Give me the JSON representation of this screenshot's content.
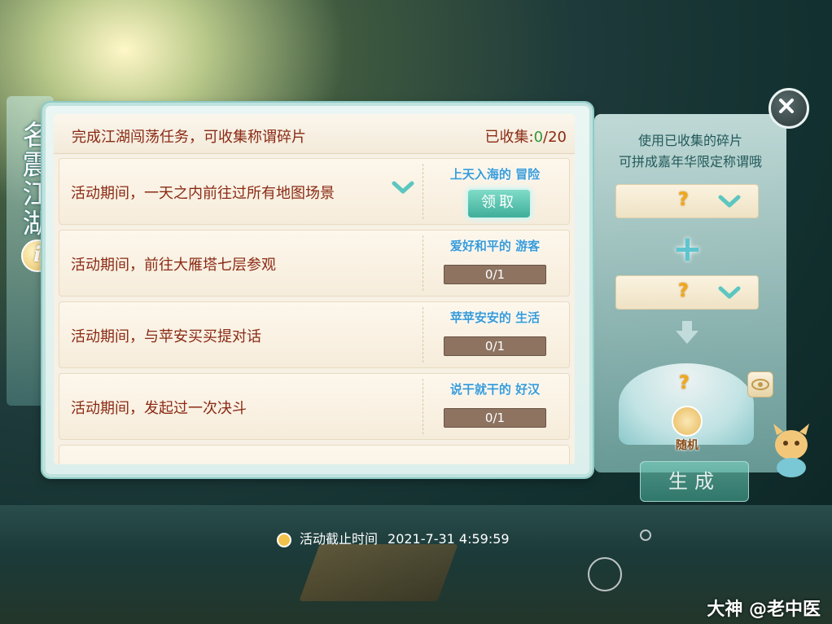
{
  "banner": {
    "title": "名震江湖",
    "info_icon": "i"
  },
  "header": {
    "title": "完成江湖闯荡任务，可收集称谓碎片",
    "collected_label": "已收集:",
    "collected_count": "0",
    "collected_total": "/20"
  },
  "tasks": [
    {
      "text": "活动期间，一天之内前往过所有地图场景",
      "reward": "上天入海的 冒险",
      "button": "领取"
    },
    {
      "text": "活动期间，前往大雁塔七层参观",
      "reward": "爱好和平的 游客",
      "progress": "0/1"
    },
    {
      "text": "活动期间，与苹安买买提对话",
      "reward": "苹苹安安的 生活",
      "progress": "0/1"
    },
    {
      "text": "活动期间，发起过一次决斗",
      "reward": "说干就干的 好汉",
      "progress": "0/1"
    }
  ],
  "right": {
    "hint_line1": "使用已收集的碎片",
    "hint_line2": "可拼成嘉年华限定称谓哦",
    "slot1": "?",
    "slot2": "?",
    "plus": "+",
    "result": "?",
    "random_label": "随机",
    "generate_label": "生成"
  },
  "footer": {
    "deadline_label": "活动截止时间",
    "deadline_value": "2021-7-31 4:59:59"
  },
  "watermark": "大神 @老中医",
  "colors": {
    "title_text": "#8a2a14",
    "count": "#2e9a3a",
    "reward_text": "#3a9bd6",
    "progress_bg": "#8d7360"
  }
}
